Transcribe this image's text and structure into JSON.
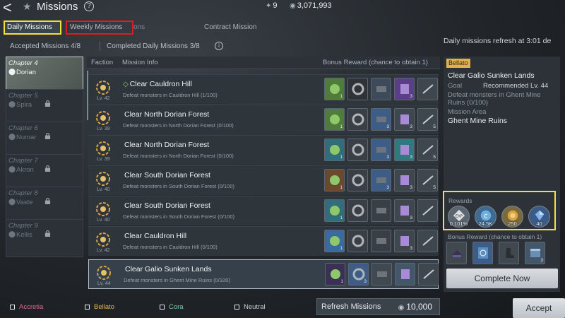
{
  "header": {
    "title": "Missions",
    "help": "?",
    "resource1": "9",
    "resource2": "3,071,993"
  },
  "tabs": [
    {
      "label": "Daily Missions"
    },
    {
      "label": "Weekly Missions"
    },
    {
      "label": "ons"
    },
    {
      "label": "Contract Mission"
    }
  ],
  "refresh_note": "Daily missions refresh at 3:01 de",
  "stats": {
    "accepted": "Accepted Missions 4/8",
    "completed": "Completed Daily Missions 3/8",
    "info": "i"
  },
  "chapters": [
    {
      "chapter": "Chapter 4",
      "name": "Dorian"
    },
    {
      "chapter": "Chapter 5",
      "name": "Spira"
    },
    {
      "chapter": "Chapter 6",
      "name": "Numar"
    },
    {
      "chapter": "Chapter 7",
      "name": "Akron"
    },
    {
      "chapter": "Chapter 8",
      "name": "Vaste"
    },
    {
      "chapter": "Chapter 9",
      "name": "Kellis"
    }
  ],
  "table": {
    "headers": {
      "faction": "Faction",
      "info": "Mission Info",
      "bonus": "Bonus Reward (chance to obtain 1)"
    },
    "rows": [
      {
        "lv": "Lv. 42",
        "name": "Clear Cauldron Hill",
        "desc": "Defeat monsters in Cauldron Hill (1/100)",
        "check": "◇",
        "q": [
          "1",
          "",
          "",
          "3",
          ""
        ]
      },
      {
        "lv": "Lv. 39",
        "name": "Clear North Dorian Forest",
        "desc": "Defeat monsters in North Dorian Forest (0/100)",
        "check": "",
        "q": [
          "1",
          "",
          "3",
          "3",
          "5"
        ]
      },
      {
        "lv": "Lv. 39",
        "name": "Clear North Dorian Forest",
        "desc": "Defeat monsters in North Dorian Forest (0/100)",
        "check": "",
        "q": [
          "1",
          "",
          "3",
          "3",
          "5"
        ]
      },
      {
        "lv": "Lv. 40",
        "name": "Clear South Dorian Forest",
        "desc": "Defeat monsters in South Dorian Forest (0/100)",
        "check": "",
        "q": [
          "1",
          "",
          "3",
          "3",
          "5"
        ]
      },
      {
        "lv": "Lv. 40",
        "name": "Clear South Dorian Forest",
        "desc": "Defeat monsters in South Dorian Forest (0/100)",
        "check": "",
        "q": [
          "1",
          "",
          "",
          "3",
          ""
        ]
      },
      {
        "lv": "Lv. 42",
        "name": "Clear Cauldron Hill",
        "desc": "Defeat monsters in Cauldron Hill (0/100)",
        "check": "",
        "q": [
          "1",
          "",
          "",
          "3",
          ""
        ]
      },
      {
        "lv": "Lv. 44",
        "name": "Clear Galio Sunken Lands",
        "desc": "Defeat monsters in Ghent Mine Ruins (0/100)",
        "check": "",
        "q": [
          "1",
          "3",
          "",
          "",
          ""
        ]
      }
    ]
  },
  "panel": {
    "tag": "Bellato",
    "title": "Clear Galio Sunken Lands",
    "goal_label": "Goal",
    "goal_value": "Recommended Lv. 44",
    "desc": "Defeat monsters in Ghent Mine Ruins (0/100)",
    "area_label": "Mission Area",
    "area_value": "Ghent Mine Ruins",
    "rewards_label": "Rewards",
    "rewards": [
      {
        "icon": "exp-icon",
        "q": "0.101%"
      },
      {
        "icon": "credit-icon",
        "q": "24.5K"
      },
      {
        "icon": "gold-coin-icon",
        "q": "250"
      },
      {
        "icon": "blue-gem-icon",
        "q": "40"
      }
    ],
    "bonus_label": "Bonus Reward (chance to obtain 1)",
    "bonus_q": [
      "",
      "",
      "",
      "3"
    ],
    "complete_label": "Complete Now"
  },
  "legend": [
    {
      "label": "Accretia"
    },
    {
      "label": "Bellato"
    },
    {
      "label": "Cora"
    },
    {
      "label": "Neutral"
    }
  ],
  "footer": {
    "refresh_label": "Refresh Missions",
    "refresh_cost": "10,000",
    "accept_label": "Accept"
  },
  "colors": {
    "highlight_yellow": "#f2e13c",
    "highlight_red": "#d41f28",
    "bellato_tag": "#e3b14a"
  }
}
